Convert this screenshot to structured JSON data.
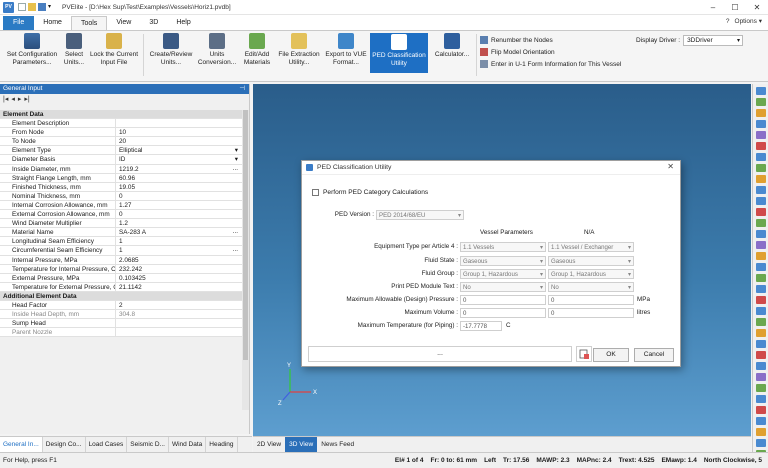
{
  "titlebar": {
    "app_icon": "PV",
    "title": "PVElite - [D:\\Hex Sup\\Test\\Examples\\Vessels\\Horiz1.pvdb]",
    "minimize": "–",
    "maximize": "☐",
    "close": "✕"
  },
  "tabs": [
    "File",
    "Home",
    "Tools",
    "View",
    "3D",
    "Help"
  ],
  "active_tab": "Tools",
  "options": {
    "help": "?",
    "label": "Options",
    "arrow": "▾"
  },
  "ribbon": {
    "buttons": [
      {
        "label": "Set Configuration Parameters..."
      },
      {
        "label": "Select Units..."
      },
      {
        "label": "Lock the Current Input File"
      },
      {
        "label": "Create/Review Units..."
      },
      {
        "label": "Units Conversion..."
      },
      {
        "label": "Edit/Add Materials"
      },
      {
        "label": "File Extraction Utility..."
      },
      {
        "label": "Export to VUE Format..."
      },
      {
        "label": "PED Classification Utility"
      },
      {
        "label": "Calculator..."
      }
    ],
    "small_commands": [
      "Renumber the Nodes",
      "Flip Model Orientation",
      "Enter in U-1 Form Information for This Vessel"
    ],
    "display_driver_label": "Display Driver :",
    "display_driver_value": "3DDriver"
  },
  "left_panel": {
    "title": "General Input",
    "toolbar": [
      "|◂",
      "◂",
      "▸",
      "▸|"
    ],
    "rows": [
      {
        "type": "cat",
        "label": "Element Data"
      },
      {
        "label": "Element Description",
        "value": ""
      },
      {
        "label": "From Node",
        "value": "10"
      },
      {
        "label": "To Node",
        "value": "20"
      },
      {
        "label": "Element Type",
        "value": "Elliptical",
        "ctrl": "dd"
      },
      {
        "label": "Diameter Basis",
        "value": "ID",
        "ctrl": "dd"
      },
      {
        "label": "Inside Diameter, mm",
        "value": "1219.2",
        "ctrl": "el"
      },
      {
        "label": "Straight Flange Length, mm",
        "value": "60.96"
      },
      {
        "label": "Finished Thickness, mm",
        "value": "19.05"
      },
      {
        "label": "Nominal Thickness, mm",
        "value": "0"
      },
      {
        "label": "Internal Corrosion Allowance, mm",
        "value": "1.27"
      },
      {
        "label": "External Corrosion Allowance, mm",
        "value": "0"
      },
      {
        "label": "Wind Diameter Multiplier",
        "value": "1.2"
      },
      {
        "label": "Material Name",
        "value": "SA-283 A",
        "ctrl": "el"
      },
      {
        "label": "Longitudinal Seam Efficiency",
        "value": "1"
      },
      {
        "label": "Circumferential Seam Efficiency",
        "value": "1",
        "ctrl": "el"
      },
      {
        "label": "Internal Pressure, MPa",
        "value": "2.0685"
      },
      {
        "label": "Temperature for Internal Pressure, C",
        "value": "232.242"
      },
      {
        "label": "External Pressure, MPa",
        "value": "0.103425"
      },
      {
        "label": "Temperature for External Pressure, C",
        "value": "21.1142"
      },
      {
        "type": "cat",
        "label": "Additional Element Data"
      },
      {
        "label": "Head Factor",
        "value": "2"
      },
      {
        "label": "Inside Head Depth, mm",
        "value": "304.8",
        "gray": true
      },
      {
        "label": "Sump Head",
        "value": ""
      },
      {
        "label": "Parent Nozzle",
        "value": "",
        "gray": true
      }
    ]
  },
  "bottom_tabs": [
    "General In...",
    "Design Co...",
    "Load Cases",
    "Seismic D...",
    "Wind Data",
    "Heading"
  ],
  "view_tabs": [
    "2D View",
    "3D View",
    "News Feed"
  ],
  "active_view_tab": "3D View",
  "dialog": {
    "title": "PED Classification Utility",
    "close": "✕",
    "perform_label": "Perform PED Category Calculations",
    "ped_version_label": "PED Version :",
    "ped_version_value": "PED 2014/68/EU",
    "col_vessel": "Vessel Parameters",
    "col_na": "N/A",
    "fields": [
      {
        "label": "Equipment Type per Article 4 :",
        "v1": "1.1 Vessels",
        "v2": "1.1 Vessel / Exchanger",
        "kind": "sel"
      },
      {
        "label": "Fluid State :",
        "v1": "Gaseous",
        "v2": "Gaseous",
        "kind": "sel"
      },
      {
        "label": "Fluid Group :",
        "v1": "Group 1, Hazardous",
        "v2": "Group 1, Hazardous",
        "kind": "sel"
      },
      {
        "label": "Print PED Module Text :",
        "v1": "No",
        "v2": "No",
        "kind": "sel"
      },
      {
        "label": "Maximum Allowable (Design) Pressure :",
        "v1": "0",
        "v2": "0",
        "kind": "inp",
        "unit": "MPa"
      },
      {
        "label": "Maximum Volume :",
        "v1": "0",
        "v2": "0",
        "kind": "inp",
        "unit": "litres"
      },
      {
        "label": "Maximum Temperature (for Piping) :",
        "v1": "-17.7778",
        "kind": "inp1",
        "unit": "C"
      }
    ],
    "footer_text": "...",
    "ok": "OK",
    "cancel": "Cancel"
  },
  "axes": {
    "x": "X",
    "y": "Y",
    "z": "Z"
  },
  "status": {
    "left": "For Help, press F1",
    "items": [
      "El# 1 of 4",
      "Fr: 0 to: 61 mm",
      "Left",
      "Tr: 17.56",
      "MAWP: 2.3",
      "MAPnc: 2.4",
      "Trext: 4.525",
      "EMawp: 1.4",
      "North Clockwise, 5"
    ]
  },
  "colors": {
    "accent": "#1e6fc4",
    "panel_head": "#2b6fb8"
  }
}
